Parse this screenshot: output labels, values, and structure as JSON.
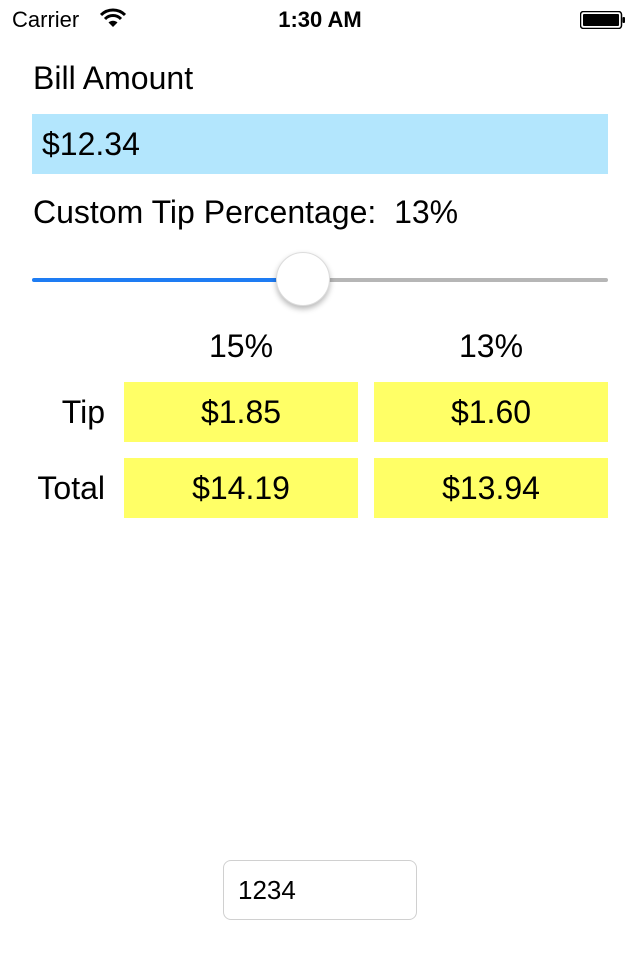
{
  "status_bar": {
    "carrier": "Carrier",
    "time": "1:30 AM"
  },
  "bill": {
    "label": "Bill Amount",
    "value": "$12.34"
  },
  "custom_tip": {
    "label": "Custom Tip Percentage:",
    "value": "13%",
    "slider_level": 0.47
  },
  "columns": [
    "15%",
    "13%"
  ],
  "rows": [
    {
      "label": "Tip",
      "values": [
        "$1.85",
        "$1.60"
      ]
    },
    {
      "label": "Total",
      "values": [
        "$14.19",
        "$13.94"
      ]
    }
  ],
  "bottom_field": {
    "value": "1234"
  },
  "colors": {
    "input_bg": "#b3e6fd",
    "cell_bg": "#ffff66",
    "slider_min": "#1e7cf3",
    "slider_max": "#b6b6b6"
  },
  "icons": [
    "wifi-icon",
    "battery-icon"
  ]
}
